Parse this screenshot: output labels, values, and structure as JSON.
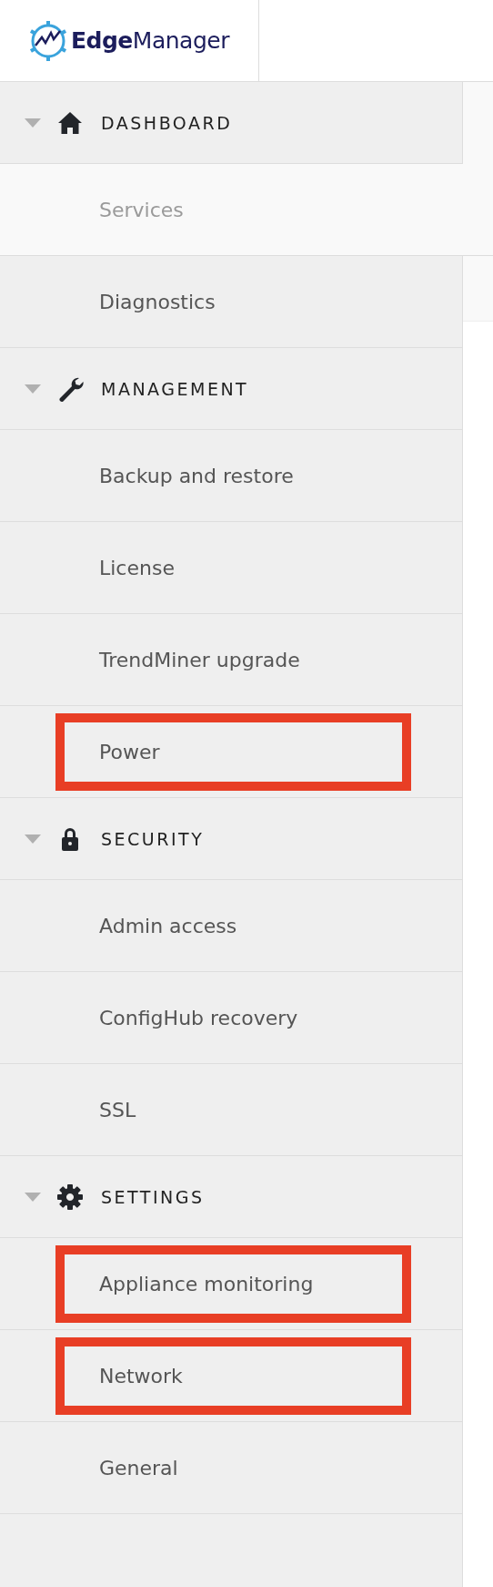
{
  "logo": {
    "text": "**Edge**Manager"
  },
  "sidebar": {
    "groups": [
      {
        "label": "DASHBOARD",
        "kind": "home",
        "expanded": true,
        "items": [
          {
            "label": "Services",
            "selected": true,
            "highlighted": false
          },
          {
            "label": "Diagnostics",
            "selected": false,
            "highlighted": false
          }
        ]
      },
      {
        "label": "MANAGEMENT",
        "kind": "wrench",
        "expanded": true,
        "items": [
          {
            "label": "Backup and restore",
            "selected": false,
            "highlighted": false
          },
          {
            "label": "License",
            "selected": false,
            "highlighted": false
          },
          {
            "label": "TrendMiner upgrade",
            "selected": false,
            "highlighted": false
          },
          {
            "label": "Power",
            "selected": false,
            "highlighted": true
          }
        ]
      },
      {
        "label": "SECURITY",
        "kind": "lock",
        "expanded": true,
        "items": [
          {
            "label": "Admin access",
            "selected": false,
            "highlighted": false
          },
          {
            "label": "ConfigHub recovery",
            "selected": false,
            "highlighted": false
          },
          {
            "label": "SSL",
            "selected": false,
            "highlighted": false
          }
        ]
      },
      {
        "label": "SETTINGS",
        "kind": "gear",
        "expanded": true,
        "items": [
          {
            "label": "Appliance monitoring",
            "selected": false,
            "highlighted": true
          },
          {
            "label": "Network",
            "selected": false,
            "highlighted": true
          },
          {
            "label": "General",
            "selected": false,
            "highlighted": false
          }
        ]
      }
    ]
  }
}
